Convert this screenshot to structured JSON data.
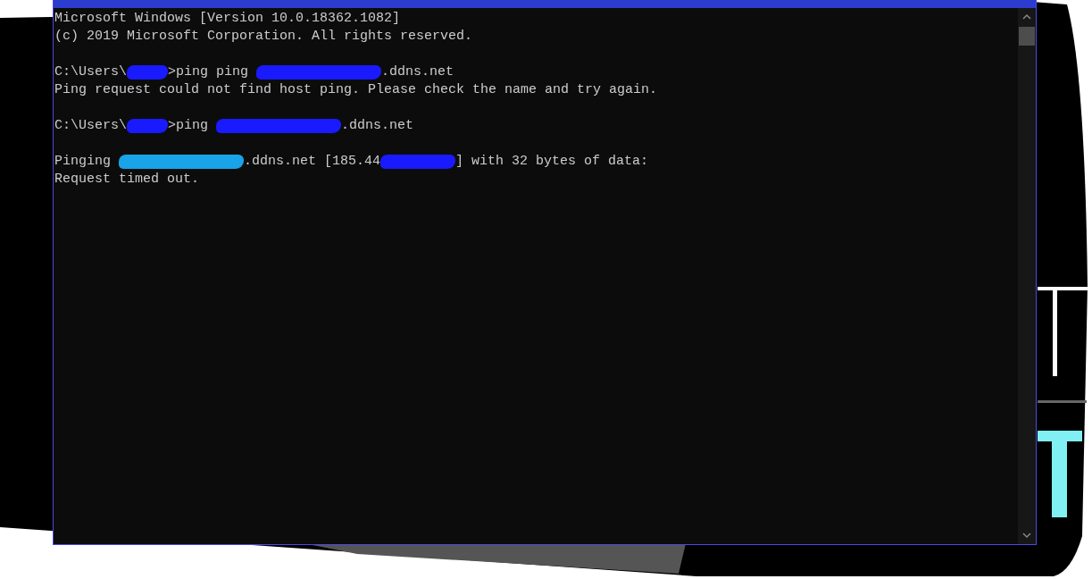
{
  "console": {
    "lines": [
      {
        "kind": "output",
        "segments": [
          {
            "kind": "text",
            "text": "Microsoft Windows [Version 10.0.18362.1082]"
          }
        ]
      },
      {
        "kind": "output",
        "segments": [
          {
            "kind": "text",
            "text": "(c) 2019 Microsoft Corporation. All rights reserved."
          }
        ]
      },
      {
        "kind": "blank"
      },
      {
        "kind": "output",
        "segments": [
          {
            "kind": "text",
            "text": "C:\\Users\\"
          },
          {
            "kind": "username",
            "color": "#1a1aff"
          },
          {
            "kind": "text",
            "text": ">ping ping "
          },
          {
            "kind": "hostname",
            "color": "#1a1aff"
          },
          {
            "kind": "text",
            "text": ".ddns.net"
          }
        ]
      },
      {
        "kind": "output",
        "segments": [
          {
            "kind": "text",
            "text": "Ping request could not find host ping. Please check the name and try again."
          }
        ]
      },
      {
        "kind": "blank"
      },
      {
        "kind": "output",
        "segments": [
          {
            "kind": "text",
            "text": "C:\\Users\\"
          },
          {
            "kind": "username",
            "color": "#1a1aff"
          },
          {
            "kind": "text",
            "text": ">ping "
          },
          {
            "kind": "hostname",
            "color": "#1a1aff"
          },
          {
            "kind": "text",
            "text": ".ddns.net"
          }
        ]
      },
      {
        "kind": "blank"
      },
      {
        "kind": "output",
        "segments": [
          {
            "kind": "text",
            "text": "Pinging "
          },
          {
            "kind": "hostname",
            "color": "#19a3e8"
          },
          {
            "kind": "text",
            "text": ".ddns.net [185.44"
          },
          {
            "kind": "address",
            "color": "#1a1aff"
          },
          {
            "kind": "text",
            "text": "] with 32 bytes of data:"
          }
        ]
      },
      {
        "kind": "output",
        "segments": [
          {
            "kind": "text",
            "text": "Request timed out."
          }
        ]
      }
    ]
  }
}
